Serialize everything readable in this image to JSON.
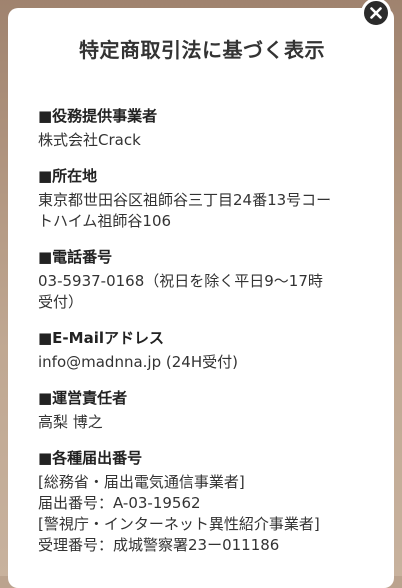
{
  "modal": {
    "title": "特定商取引法に基づく表示",
    "sections": [
      {
        "heading": "■役務提供事業者",
        "lines": [
          "株式会社Crack"
        ]
      },
      {
        "heading": "■所在地",
        "lines": [
          "東京都世田谷区祖師谷三丁目24番13号コー",
          "トハイム祖師谷106"
        ]
      },
      {
        "heading": "■電話番号",
        "lines": [
          "03-5937-0168（祝日を除く平日9〜17時",
          "受付）"
        ]
      },
      {
        "heading": "■E-Mailアドレス",
        "lines": [
          "info@madnna.jp (24H受付)"
        ]
      },
      {
        "heading": "■運営責任者",
        "lines": [
          "高梨 博之"
        ]
      },
      {
        "heading": "■各種届出番号",
        "lines": [
          "[総務省・届出電気通信事業者]",
          "届出番号：A-03-19562",
          "[警視庁・インターネット異性紹介事業者]",
          "受理番号：成城警察署23ー011186"
        ]
      }
    ]
  },
  "close_icon": "close-icon"
}
